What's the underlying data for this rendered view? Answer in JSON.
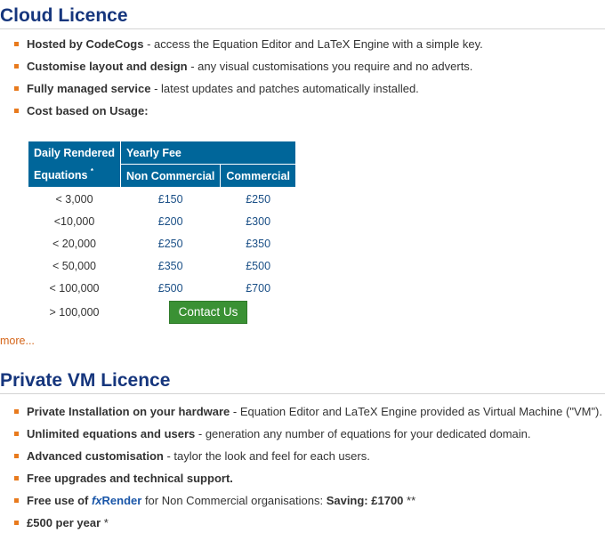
{
  "cloud": {
    "title": "Cloud Licence",
    "features": [
      {
        "bold": "Hosted by CodeCogs",
        "text": " - access the Equation Editor and LaTeX Engine with a simple key."
      },
      {
        "bold": "Customise layout and design",
        "text": " - any visual customisations you require and no adverts."
      },
      {
        "bold": "Fully managed service",
        "text": " - latest updates and patches automatically installed."
      },
      {
        "bold": "Cost based on Usage:",
        "text": ""
      }
    ],
    "table": {
      "header_left_line1": "Daily Rendered",
      "header_left_line2": "Equations",
      "header_left_mark": "*",
      "header_fee": "Yearly Fee",
      "header_noncommercial": "Non Commercial",
      "header_commercial": "Commercial",
      "rows": [
        {
          "equations": "< 3,000",
          "noncommercial": "£150",
          "commercial": "£250"
        },
        {
          "equations": "<10,000",
          "noncommercial": "£200",
          "commercial": "£300"
        },
        {
          "equations": "< 20,000",
          "noncommercial": "£250",
          "commercial": "£350"
        },
        {
          "equations": "< 50,000",
          "noncommercial": "£350",
          "commercial": "£500"
        },
        {
          "equations": "< 100,000",
          "noncommercial": "£500",
          "commercial": "£700"
        }
      ],
      "last_row_equations": "> 100,000",
      "contact_label": "Contact Us"
    },
    "more_label": "more..."
  },
  "private": {
    "title": "Private VM Licence",
    "features": [
      {
        "bold": "Private Installation on your hardware",
        "text": " - Equation Editor and LaTeX Engine provided as Virtual Machine (\"VM\")."
      },
      {
        "bold": "Unlimited equations and users",
        "text": " - generation any number of equations for your dedicated domain."
      },
      {
        "bold": "Advanced customisation",
        "text": " - taylor the look and feel for each users."
      },
      {
        "bold": "Free upgrades and technical support.",
        "text": ""
      }
    ],
    "fxrender": {
      "prefix": "Free use of ",
      "fx": "fx",
      "render": "Render",
      "suffix": " for Non Commercial organisations: ",
      "saving": "Saving: £1700",
      "mark": " **"
    },
    "price": {
      "bold": "£500 per year",
      "mark": " *"
    }
  },
  "colors": {
    "title": "#16367d",
    "table_header": "#00669a",
    "button": "#3a9134",
    "bullet": "#e87a1d",
    "link": "#d5661a"
  }
}
